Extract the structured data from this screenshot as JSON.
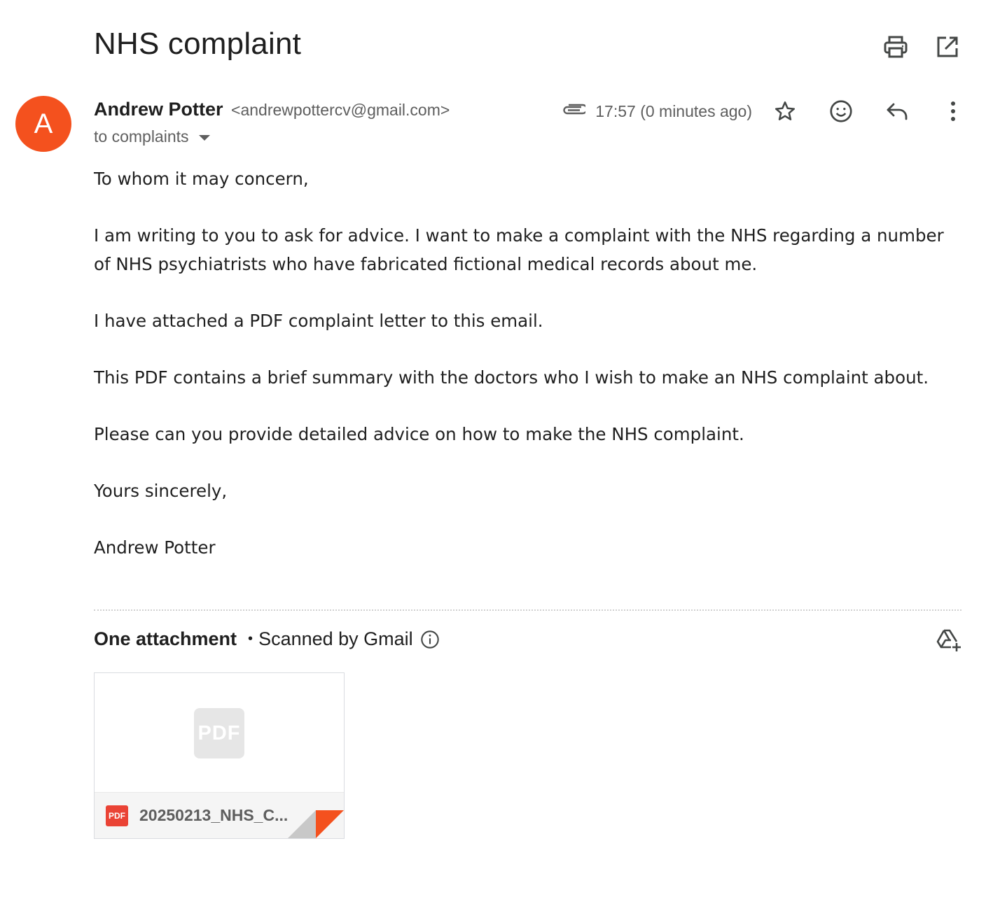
{
  "email": {
    "subject": "NHS complaint",
    "sender": {
      "avatar_letter": "A",
      "avatar_color": "#f4511e",
      "name": "Andrew Potter",
      "email": "<andrewpottercv@gmail.com>"
    },
    "recipients_label": "to complaints",
    "time": "17:57 (0 minutes ago)",
    "body": [
      "To whom it may concern,",
      "I am writing to you to ask for advice. I want to make a complaint with the NHS regarding a number of NHS psychiatrists who have fabricated fictional medical records about me.",
      "I have attached a PDF complaint letter to this email.",
      "This PDF contains a brief summary with the doctors who I wish to make an NHS complaint about.",
      "Please can you provide detailed advice on how to make the NHS complaint.",
      "Yours sincerely,",
      "Andrew Potter"
    ]
  },
  "attachments": {
    "count_label": "One attachment",
    "separator": "•",
    "scanned_label": "Scanned by Gmail",
    "file": {
      "thumb_label": "PDF",
      "type_label": "PDF",
      "name": "20250213_NHS_C..."
    }
  },
  "icons": {
    "print": "print-icon",
    "open_new_window": "open-in-new-window-icon",
    "attachment": "paperclip-icon",
    "star": "star-icon",
    "emoji": "emoji-icon",
    "reply": "reply-icon",
    "more": "more-vert-icon",
    "info": "info-icon",
    "drive_add": "add-to-drive-icon"
  },
  "colors": {
    "accent_red": "#ea4335",
    "corner_red": "#f4511e",
    "text_secondary": "#5e5e5e"
  }
}
